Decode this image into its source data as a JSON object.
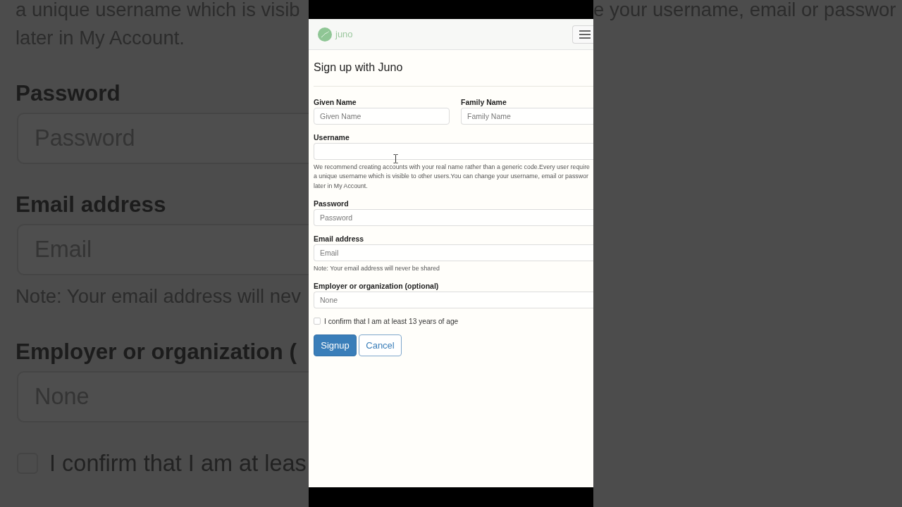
{
  "backdrop_left": [
    {
      "kind": "text",
      "text": "a unique username which is visib"
    },
    {
      "kind": "text",
      "text": "later in My Account."
    },
    {
      "kind": "label",
      "text": "Password"
    },
    {
      "kind": "field",
      "placeholder": "Password"
    },
    {
      "kind": "label",
      "text": "Email address"
    },
    {
      "kind": "field",
      "placeholder": "Email"
    },
    {
      "kind": "text",
      "text": "Note: Your email address will nev"
    },
    {
      "kind": "label",
      "text": "Employer or organization ("
    },
    {
      "kind": "field",
      "placeholder": "None"
    },
    {
      "kind": "checkbox",
      "label": "I confirm that I am at leas",
      "checked": false
    }
  ],
  "backdrop_right": [
    {
      "kind": "text",
      "text": "e your username, email or passwor"
    }
  ],
  "navbar": {
    "brand": "juno"
  },
  "page_title": "Sign up with Juno",
  "form": {
    "name_row": [
      {
        "label": "Given Name",
        "placeholder": "Given Name"
      },
      {
        "label": "Family Name",
        "placeholder": "Family Name"
      }
    ],
    "fields": [
      {
        "label": "Username",
        "help_lines": [
          "We recommend creating accounts with your real name rather than a generic code.Every user require",
          "a unique username which is visible to other users.You can change your username, email or passwor",
          "later in My Account."
        ]
      },
      {
        "label": "Password",
        "placeholder": "Password"
      },
      {
        "label": "Email address",
        "placeholder": "Email",
        "help_lines": [
          "Note: Your email address will never be shared"
        ]
      },
      {
        "label": "Employer or organization (optional)",
        "placeholder": "None"
      }
    ],
    "confirm": {
      "label": "I confirm that I am at least 13 years of age",
      "checked": false
    },
    "buttons": [
      {
        "label": "Signup",
        "kind": "primary"
      },
      {
        "label": "Cancel",
        "kind": "secondary"
      }
    ]
  }
}
